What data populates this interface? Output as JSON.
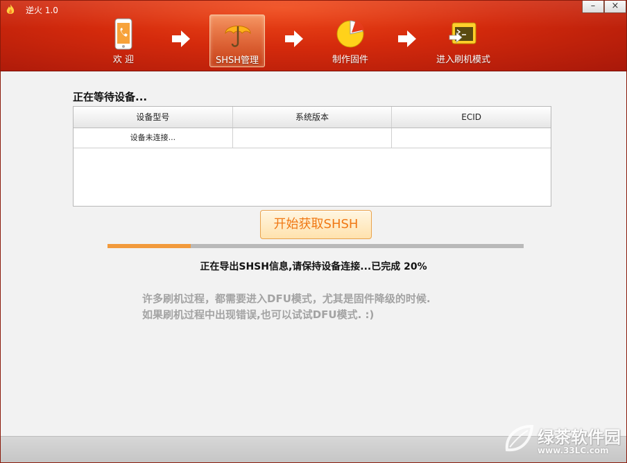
{
  "app": {
    "title": "逆火 1.0"
  },
  "window_controls": {
    "minimize": "–",
    "close": "×"
  },
  "steps": [
    {
      "label": "欢 迎",
      "icon": "phone-icon"
    },
    {
      "label": "SHSH管理",
      "icon": "umbrella-icon",
      "active": true
    },
    {
      "label": "制作固件",
      "icon": "pie-chart-icon"
    },
    {
      "label": "进入刷机模式",
      "icon": "terminal-icon"
    }
  ],
  "main": {
    "status_title": "正在等待设备...",
    "table": {
      "headers": [
        "设备型号",
        "系统版本",
        "ECID"
      ],
      "rows": [
        [
          "设备未连接...",
          "",
          ""
        ]
      ]
    },
    "start_button": "开始获取SHSH",
    "progress": {
      "value": 0.2,
      "text": "正在导出SHSH信息,请保持设备连接...已完成 20%"
    },
    "tips": [
      "许多刷机过程，都需要进入DFU模式，尤其是固件降级的时候.",
      "如果刷机过程中出现错误,也可以试试DFU模式. :)"
    ]
  },
  "watermark": {
    "name": "绿茶软件园",
    "url": "www.33LC.com"
  },
  "colors": {
    "header_red": "#d42a0c",
    "accent_orange": "#f29a3c",
    "button_text": "#f07814",
    "tip_gray": "#a3a3a3"
  }
}
